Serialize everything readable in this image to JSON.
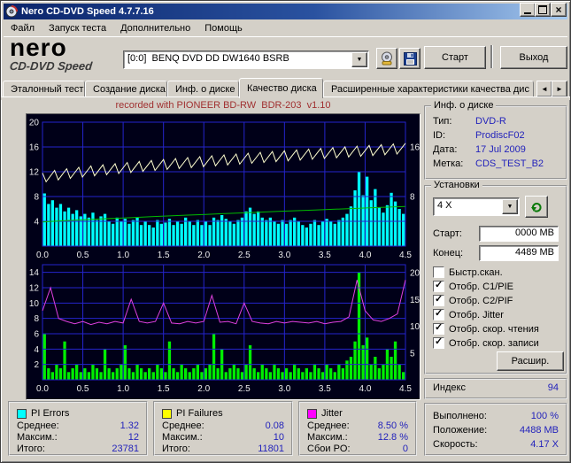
{
  "window": {
    "title": "Nero CD-DVD Speed 4.7.7.16"
  },
  "menu": {
    "items": [
      "Файл",
      "Запуск теста",
      "Дополнительно",
      "Помощь"
    ]
  },
  "toolbar": {
    "logo_main": "nero",
    "logo_sub": "CD-DVD Speed",
    "drive_value": "[0:0]  BENQ DVD DD DW1640 BSRB",
    "start": "Старт",
    "exit": "Выход"
  },
  "tabs": {
    "items": [
      "Эталонный тест",
      "Создание диска",
      "Инф. о диске",
      "Качество диска",
      "Расширенные характеристики качества дис"
    ],
    "active_index": 3
  },
  "colors": {
    "value_text": "#2323bb",
    "chart_bg": "#000018",
    "grid": "#2424cc",
    "pie_bars": "#00ffff",
    "pif_bars": "#00ee00",
    "jitter_line": "#e040e0",
    "write_speed_line": "#ffffd0",
    "read_speed_line": "#00bb00"
  },
  "chart_data": [
    {
      "type": "bar+line",
      "title": "recorded with PIONEER BD-RW  BDR-203  v1.10",
      "x_range": [
        0,
        4.5
      ],
      "x_ticks": [
        "0.0",
        "0.5",
        "1.0",
        "1.5",
        "2.0",
        "2.5",
        "3.0",
        "3.5",
        "4.0",
        "4.5"
      ],
      "y_left_range": [
        0,
        20
      ],
      "y_left_ticks": [
        20,
        16,
        12,
        8,
        4
      ],
      "y_right_ticks": [
        16,
        8
      ],
      "grid": true,
      "series": [
        {
          "name": "PI Errors",
          "type": "bar",
          "color": "#00ffff",
          "values": [
            8.5,
            6.8,
            7.4,
            6.2,
            6.8,
            5.6,
            6.2,
            5.2,
            5.8,
            4.8,
            5.2,
            4.6,
            5.4,
            4.2,
            4.8,
            5.2,
            4.0,
            3.6,
            4.6,
            4.0,
            4.4,
            3.6,
            4.2,
            4.6,
            3.4,
            4.0,
            3.4,
            3.0,
            4.2,
            3.6,
            3.8,
            4.4,
            3.4,
            4.0,
            3.6,
            4.6,
            4.0,
            3.4,
            4.2,
            3.4,
            4.0,
            3.4,
            4.6,
            4.2,
            5.0,
            4.4,
            4.0,
            3.6,
            4.2,
            4.6,
            5.6,
            6.2,
            5.2,
            5.6,
            4.6,
            4.2,
            4.6,
            4.0,
            3.6,
            4.2,
            3.6,
            4.2,
            4.6,
            4.0,
            3.4,
            3.0,
            3.6,
            4.2,
            3.4,
            4.0,
            4.4,
            4.0,
            3.6,
            4.2,
            4.6,
            5.2,
            6.4,
            9.0,
            12.0,
            8.2,
            11.2,
            7.4,
            9.2,
            6.2,
            5.4,
            6.6,
            8.6,
            7.2,
            6.0,
            5.2
          ]
        },
        {
          "name": "Скорость записи",
          "type": "line",
          "style": "sawtooth",
          "color": "#ffffd0",
          "start": 11.8,
          "end": 16.6,
          "dip": 1.7,
          "dips": 30
        },
        {
          "name": "Скорость чтения",
          "type": "line",
          "color": "#00bb00",
          "start": 3.9,
          "end": 6.4
        }
      ]
    },
    {
      "type": "bar+line",
      "title": "",
      "x_range": [
        0,
        4.5
      ],
      "x_ticks": [
        "0.0",
        "0.5",
        "1.0",
        "1.5",
        "2.0",
        "2.5",
        "3.0",
        "3.5",
        "4.0",
        "4.5"
      ],
      "y_left_range": [
        0,
        15
      ],
      "y_left_ticks": [
        14,
        12,
        10,
        8,
        6,
        4,
        2
      ],
      "y_right_range": [
        0,
        21.5
      ],
      "y_right_ticks": [
        20,
        15,
        10,
        5
      ],
      "grid": true,
      "series": [
        {
          "name": "PI Failures",
          "type": "bar",
          "color": "#00ee00",
          "values": [
            6.0,
            1.5,
            1.0,
            2.0,
            1.5,
            5.0,
            1.0,
            1.5,
            2.0,
            1.0,
            1.5,
            1.0,
            2.0,
            1.5,
            1.0,
            4.0,
            1.5,
            1.0,
            1.5,
            2.0,
            4.5,
            1.5,
            1.0,
            2.0,
            1.5,
            1.0,
            1.5,
            1.0,
            2.0,
            1.5,
            1.0,
            5.0,
            1.5,
            1.0,
            2.0,
            1.5,
            1.0,
            1.5,
            2.0,
            1.0,
            1.5,
            2.0,
            6.0,
            1.5,
            4.0,
            1.0,
            1.5,
            2.0,
            1.5,
            1.0,
            2.0,
            4.5,
            1.5,
            1.0,
            2.0,
            1.5,
            1.0,
            2.0,
            1.5,
            1.0,
            1.5,
            1.0,
            2.0,
            1.5,
            1.0,
            1.5,
            1.0,
            2.0,
            1.5,
            1.0,
            2.0,
            1.5,
            1.0,
            2.0,
            1.5,
            2.5,
            3.0,
            5.0,
            14.0,
            4.5,
            5.5,
            2.0,
            3.0,
            1.5,
            2.0,
            4.0,
            3.0,
            5.0,
            2.0,
            1.0
          ]
        },
        {
          "name": "Jitter",
          "type": "line",
          "color": "#e040e0",
          "x_step": 0.1,
          "values": [
            9.0,
            12.0,
            8.0,
            7.6,
            7.3,
            7.6,
            7.2,
            7.5,
            7.3,
            7.6,
            7.4,
            10.5,
            7.6,
            7.4,
            7.6,
            10.0,
            7.4,
            7.3,
            7.6,
            7.4,
            7.6,
            11.0,
            7.5,
            7.6,
            7.3,
            10.0,
            7.6,
            7.4,
            7.3,
            7.6,
            7.4,
            7.6,
            7.5,
            7.4,
            7.6,
            7.3,
            7.5,
            7.6,
            8.2,
            13.0,
            9.0,
            7.8,
            7.6,
            8.0,
            8.6,
            13.0
          ]
        }
      ]
    }
  ],
  "disc_info": {
    "title": "Инф. о диске",
    "rows": [
      {
        "label": "Тип:",
        "value": "DVD-R"
      },
      {
        "label": "ID:",
        "value": "ProdiscF02"
      },
      {
        "label": "Дата:",
        "value": "17 Jul 2009"
      },
      {
        "label": "Метка:",
        "value": "CDS_TEST_B2"
      }
    ]
  },
  "settings": {
    "title": "Установки",
    "speed_value": "4 X",
    "start_label": "Старт:",
    "start_value": "0000 MB",
    "end_label": "Конец:",
    "end_value": "4489 MB",
    "checkboxes": [
      {
        "label": "Быстр.скан.",
        "checked": false
      },
      {
        "label": "Отобр. C1/PIE",
        "checked": true
      },
      {
        "label": "Отобр. C2/PIF",
        "checked": true
      },
      {
        "label": "Отобр. Jitter",
        "checked": true
      },
      {
        "label": "Отобр. скор. чтения",
        "checked": true
      },
      {
        "label": "Отобр. скор. записи",
        "checked": true
      }
    ],
    "more_label": "Расшир."
  },
  "index_panel": {
    "label": "Индекс",
    "value": "94"
  },
  "status_panel": {
    "rows": [
      {
        "label": "Выполнено:",
        "value": "100 %"
      },
      {
        "label": "Положение:",
        "value": "4488 MB"
      },
      {
        "label": "Скорость:",
        "value": "4.17 X"
      }
    ]
  },
  "stats": {
    "boxes": [
      {
        "title": "PI Errors",
        "legend_color": "#00ffff",
        "rows": [
          {
            "label": "Среднее:",
            "value": "1.32"
          },
          {
            "label": "Максим.:",
            "value": "12"
          },
          {
            "label": "Итого:",
            "value": "23781"
          }
        ]
      },
      {
        "title": "PI Failures",
        "legend_color": "#ffff00",
        "rows": [
          {
            "label": "Среднее:",
            "value": "0.08"
          },
          {
            "label": "Максим.:",
            "value": "10"
          },
          {
            "label": "Итого:",
            "value": "11801"
          }
        ]
      },
      {
        "title": "Jitter",
        "legend_color": "#ff00ff",
        "rows": [
          {
            "label": "Среднее:",
            "value": "8.50 %"
          },
          {
            "label": "Максим.:",
            "value": "12.8 %"
          },
          {
            "label": "Сбои PO:",
            "value": "0"
          }
        ]
      }
    ]
  }
}
